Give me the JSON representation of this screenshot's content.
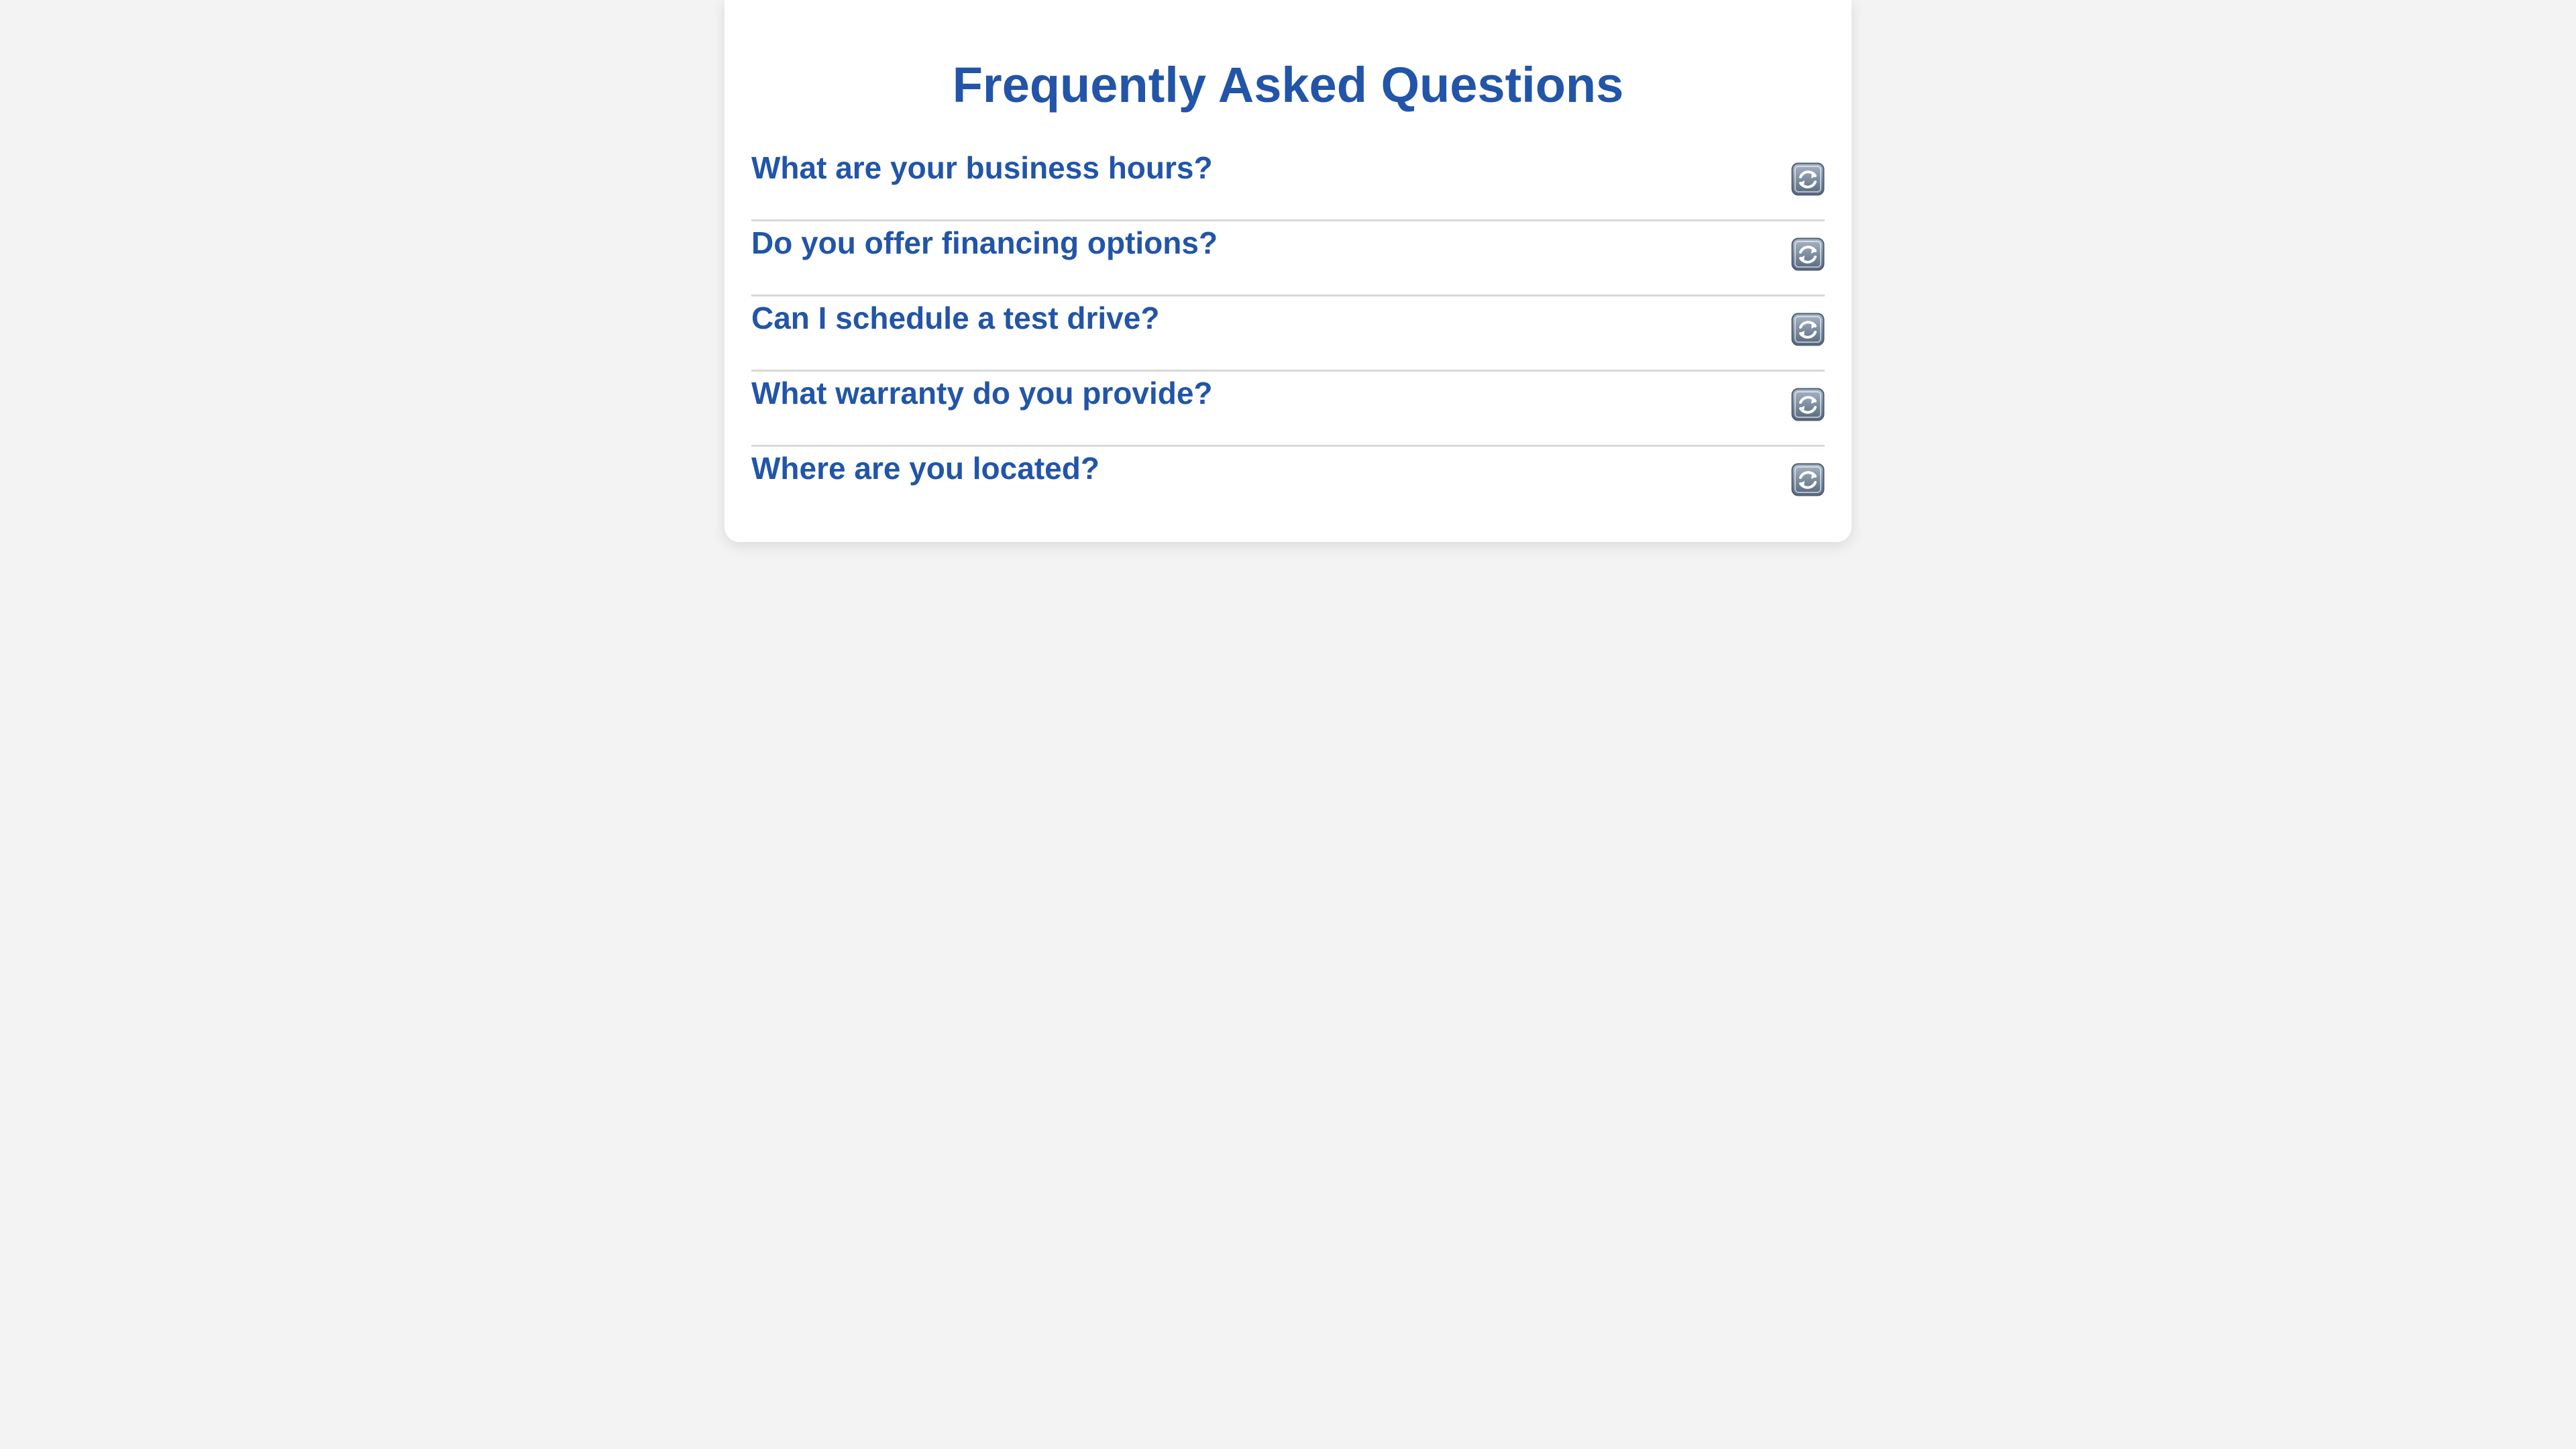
{
  "faq": {
    "title": "Frequently Asked Questions",
    "items": [
      {
        "question": "What are your business hours?",
        "icon": "refresh-icon"
      },
      {
        "question": "Do you offer financing options?",
        "icon": "refresh-icon"
      },
      {
        "question": "Can I schedule a test drive?",
        "icon": "refresh-icon"
      },
      {
        "question": "What warranty do you provide?",
        "icon": "refresh-icon"
      },
      {
        "question": "Where are you located?",
        "icon": "refresh-icon"
      }
    ]
  },
  "colors": {
    "page_background": "#f3f3f3",
    "card_background": "#ffffff",
    "accent": "#2255a8",
    "divider": "#d8d8d8",
    "icon": "#6d7f95"
  }
}
